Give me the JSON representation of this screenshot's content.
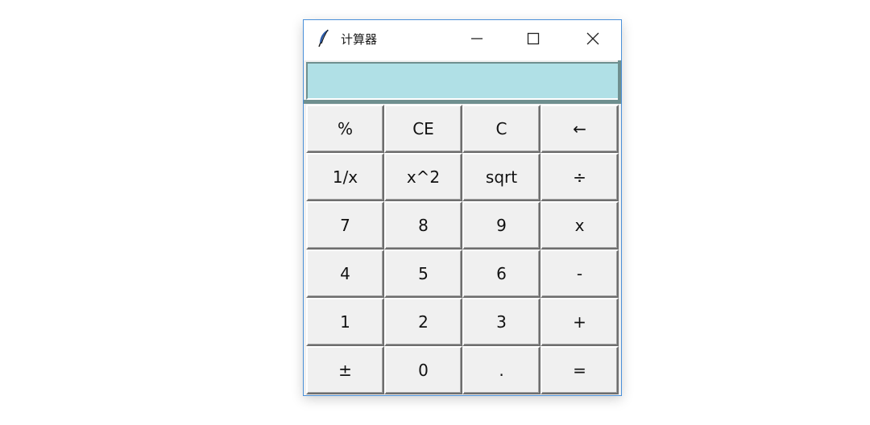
{
  "window": {
    "title": "计算器",
    "icons": {
      "app": "feather-icon",
      "minimize": "minimize-icon",
      "maximize": "maximize-icon",
      "close": "close-icon"
    }
  },
  "display": {
    "value": "",
    "background": "#b0e0e6"
  },
  "keypad": {
    "rows": [
      [
        {
          "label": "%",
          "name": "percent"
        },
        {
          "label": "CE",
          "name": "clear-entry"
        },
        {
          "label": "C",
          "name": "clear"
        },
        {
          "label": "←",
          "name": "backspace"
        }
      ],
      [
        {
          "label": "1/x",
          "name": "reciprocal"
        },
        {
          "label": "x^2",
          "name": "square"
        },
        {
          "label": "sqrt",
          "name": "square-root"
        },
        {
          "label": "÷",
          "name": "divide"
        }
      ],
      [
        {
          "label": "7",
          "name": "digit-7"
        },
        {
          "label": "8",
          "name": "digit-8"
        },
        {
          "label": "9",
          "name": "digit-9"
        },
        {
          "label": "x",
          "name": "multiply"
        }
      ],
      [
        {
          "label": "4",
          "name": "digit-4"
        },
        {
          "label": "5",
          "name": "digit-5"
        },
        {
          "label": "6",
          "name": "digit-6"
        },
        {
          "label": "-",
          "name": "subtract"
        }
      ],
      [
        {
          "label": "1",
          "name": "digit-1"
        },
        {
          "label": "2",
          "name": "digit-2"
        },
        {
          "label": "3",
          "name": "digit-3"
        },
        {
          "label": "+",
          "name": "add"
        }
      ],
      [
        {
          "label": "±",
          "name": "negate"
        },
        {
          "label": "0",
          "name": "digit-0"
        },
        {
          "label": ".",
          "name": "decimal-point"
        },
        {
          "label": "=",
          "name": "equals"
        }
      ]
    ]
  }
}
